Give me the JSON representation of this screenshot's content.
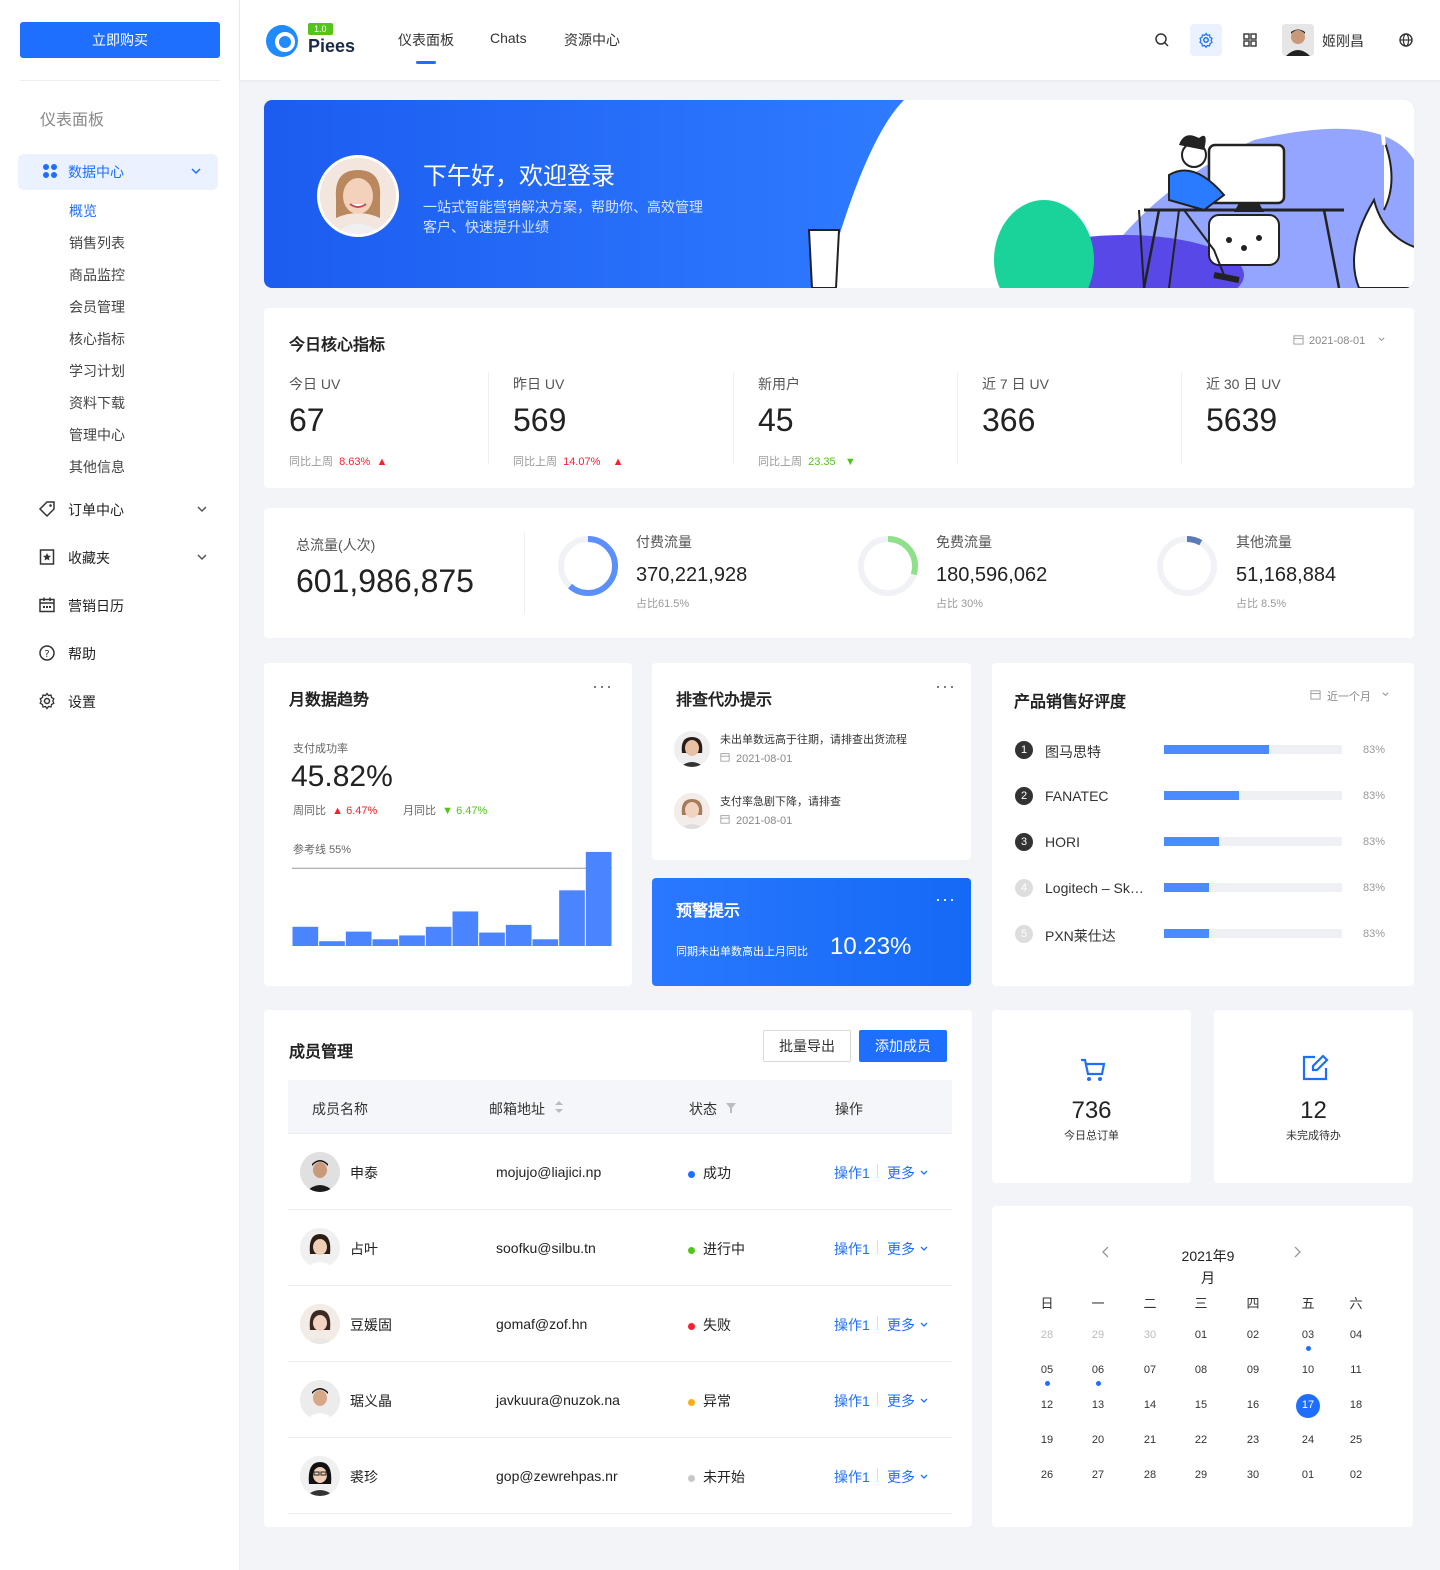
{
  "sidebar": {
    "buy_label": "立即购买",
    "section_title": "仪表面板",
    "active_group": {
      "label": "数据中心",
      "icon": "grid-icon"
    },
    "subitems": [
      "概览",
      "销售列表",
      "商品监控",
      "会员管理",
      "核心指标",
      "学习计划",
      "资料下载",
      "管理中心",
      "其他信息"
    ],
    "items": [
      {
        "label": "订单中心",
        "icon": "tag-icon",
        "has_children": true
      },
      {
        "label": "收藏夹",
        "icon": "bookmark-icon",
        "has_children": true
      },
      {
        "label": "营销日历",
        "icon": "calendar-icon",
        "has_children": false
      },
      {
        "label": "帮助",
        "icon": "help-icon",
        "has_children": false
      },
      {
        "label": "设置",
        "icon": "gear-icon",
        "has_children": false
      }
    ]
  },
  "header": {
    "logo_text": "Piees",
    "logo_version": "1.0",
    "nav": [
      "仪表面板",
      "Chats",
      "资源中心"
    ],
    "active_nav": 0,
    "username": "姬刚昌"
  },
  "banner": {
    "title": "下午好，欢迎登录",
    "subtitle": "一站式智能营销解决方案，帮助你、高效管理客户、快速提升业绩"
  },
  "core_metrics": {
    "title": "今日核心指标",
    "date": "2021-08-01",
    "items": [
      {
        "label": "今日 UV",
        "value": "67",
        "compare_label": "同比上周",
        "compare_value": "8.63%",
        "trend": "up"
      },
      {
        "label": "昨日 UV",
        "value": "569",
        "compare_label": "同比上周",
        "compare_value": "14.07%",
        "trend": "up"
      },
      {
        "label": "新用户",
        "value": "45",
        "compare_label": "同比上周",
        "compare_value": "23.35",
        "trend": "down"
      },
      {
        "label": "近 7 日 UV",
        "value": "366"
      },
      {
        "label": "近 30 日 UV",
        "value": "5639"
      }
    ]
  },
  "traffic": {
    "total_label": "总流量(人次)",
    "total_value": "601,986,875",
    "items": [
      {
        "label": "付费流量",
        "value": "370,221,928",
        "share": "占比61.5%",
        "ratio": 0.615,
        "color": "#5b8ff9"
      },
      {
        "label": "免费流量",
        "value": "180,596,062",
        "share": "占比 30%",
        "ratio": 0.3,
        "color": "#8ee08a"
      },
      {
        "label": "其他流量",
        "value": "51,168,884",
        "share": "占比 8.5%",
        "ratio": 0.085,
        "color": "#5b7bb8"
      }
    ]
  },
  "monthly": {
    "title": "月数据趋势",
    "metric_label": "支付成功率",
    "metric_value": "45.82%",
    "wow_label": "周同比",
    "wow_value": "6.47%",
    "mom_label": "月同比",
    "mom_value": "6.47%",
    "ref_label": "参考线 55%"
  },
  "chart_data": {
    "type": "bar",
    "values": [
      20,
      5,
      15,
      7,
      11,
      20,
      36,
      14,
      22,
      7,
      58,
      98
    ],
    "reference_line": 81,
    "ylim": [
      0,
      100
    ]
  },
  "todos": {
    "title": "排查代办提示",
    "items": [
      {
        "text": "未出单数远高于往期，请排查出货流程",
        "date": "2021-08-01"
      },
      {
        "text": "支付率急剧下降，请排查",
        "date": "2021-08-01"
      }
    ]
  },
  "warning": {
    "title": "预警提示",
    "text": "同期未出单数高出上月同比",
    "value": "10.23%"
  },
  "ranking": {
    "title": "产品销售好评度",
    "range": "近一个月",
    "items": [
      {
        "rank": "1",
        "name": "图马思特",
        "ratio": 0.59,
        "pct": "83%"
      },
      {
        "rank": "2",
        "name": "FANATEC",
        "ratio": 0.42,
        "pct": "83%"
      },
      {
        "rank": "3",
        "name": "HORI",
        "ratio": 0.31,
        "pct": "83%"
      },
      {
        "rank": "4",
        "name": "Logitech – Ske…",
        "ratio": 0.25,
        "pct": "83%"
      },
      {
        "rank": "5",
        "name": "PXN莱仕达",
        "ratio": 0.25,
        "pct": "83%"
      }
    ]
  },
  "members": {
    "title": "成员管理",
    "export_label": "批量导出",
    "add_label": "添加成员",
    "columns": [
      "成员名称",
      "邮箱地址",
      "状态",
      "操作"
    ],
    "rows": [
      {
        "name": "申泰",
        "email": "mojujo@liajici.np",
        "status": "成功",
        "status_color": "#1f6fff",
        "op": "操作1",
        "more": "更多"
      },
      {
        "name": "占叶",
        "email": "soofku@silbu.tn",
        "status": "进行中",
        "status_color": "#52c41a",
        "op": "操作1",
        "more": "更多"
      },
      {
        "name": "豆媛固",
        "email": "gomaf@zof.hn",
        "status": "失败",
        "status_color": "#f5222d",
        "op": "操作1",
        "more": "更多"
      },
      {
        "name": "琚义晶",
        "email": "javkuura@nuzok.na",
        "status": "异常",
        "status_color": "#faad14",
        "op": "操作1",
        "more": "更多"
      },
      {
        "name": "裘珍",
        "email": "gop@zewrehpas.nr",
        "status": "未开始",
        "status_color": "#c8c8c8",
        "op": "操作1",
        "more": "更多"
      }
    ]
  },
  "stats": [
    {
      "value": "736",
      "label": "今日总订单",
      "icon": "cart-icon"
    },
    {
      "value": "12",
      "label": "未完成待办",
      "icon": "edit-icon"
    }
  ],
  "calendar": {
    "title_line1": "2021年9",
    "title_line2": "月",
    "weekdays": [
      "日",
      "一",
      "二",
      "三",
      "四",
      "五",
      "六"
    ],
    "weeks": [
      [
        "28",
        "29",
        "30",
        "01",
        "02",
        "03",
        "04"
      ],
      [
        "05",
        "06",
        "07",
        "08",
        "09",
        "10",
        "11"
      ],
      [
        "12",
        "13",
        "14",
        "15",
        "16",
        "17",
        "18"
      ],
      [
        "19",
        "20",
        "21",
        "22",
        "23",
        "24",
        "25"
      ],
      [
        "26",
        "27",
        "28",
        "29",
        "30",
        "01",
        "02"
      ]
    ],
    "muted": [
      [
        0,
        0
      ],
      [
        0,
        1
      ],
      [
        0,
        2
      ]
    ],
    "today": [
      2,
      5
    ],
    "event_dots": [
      [
        0,
        5
      ],
      [
        1,
        0
      ],
      [
        1,
        1
      ]
    ]
  }
}
